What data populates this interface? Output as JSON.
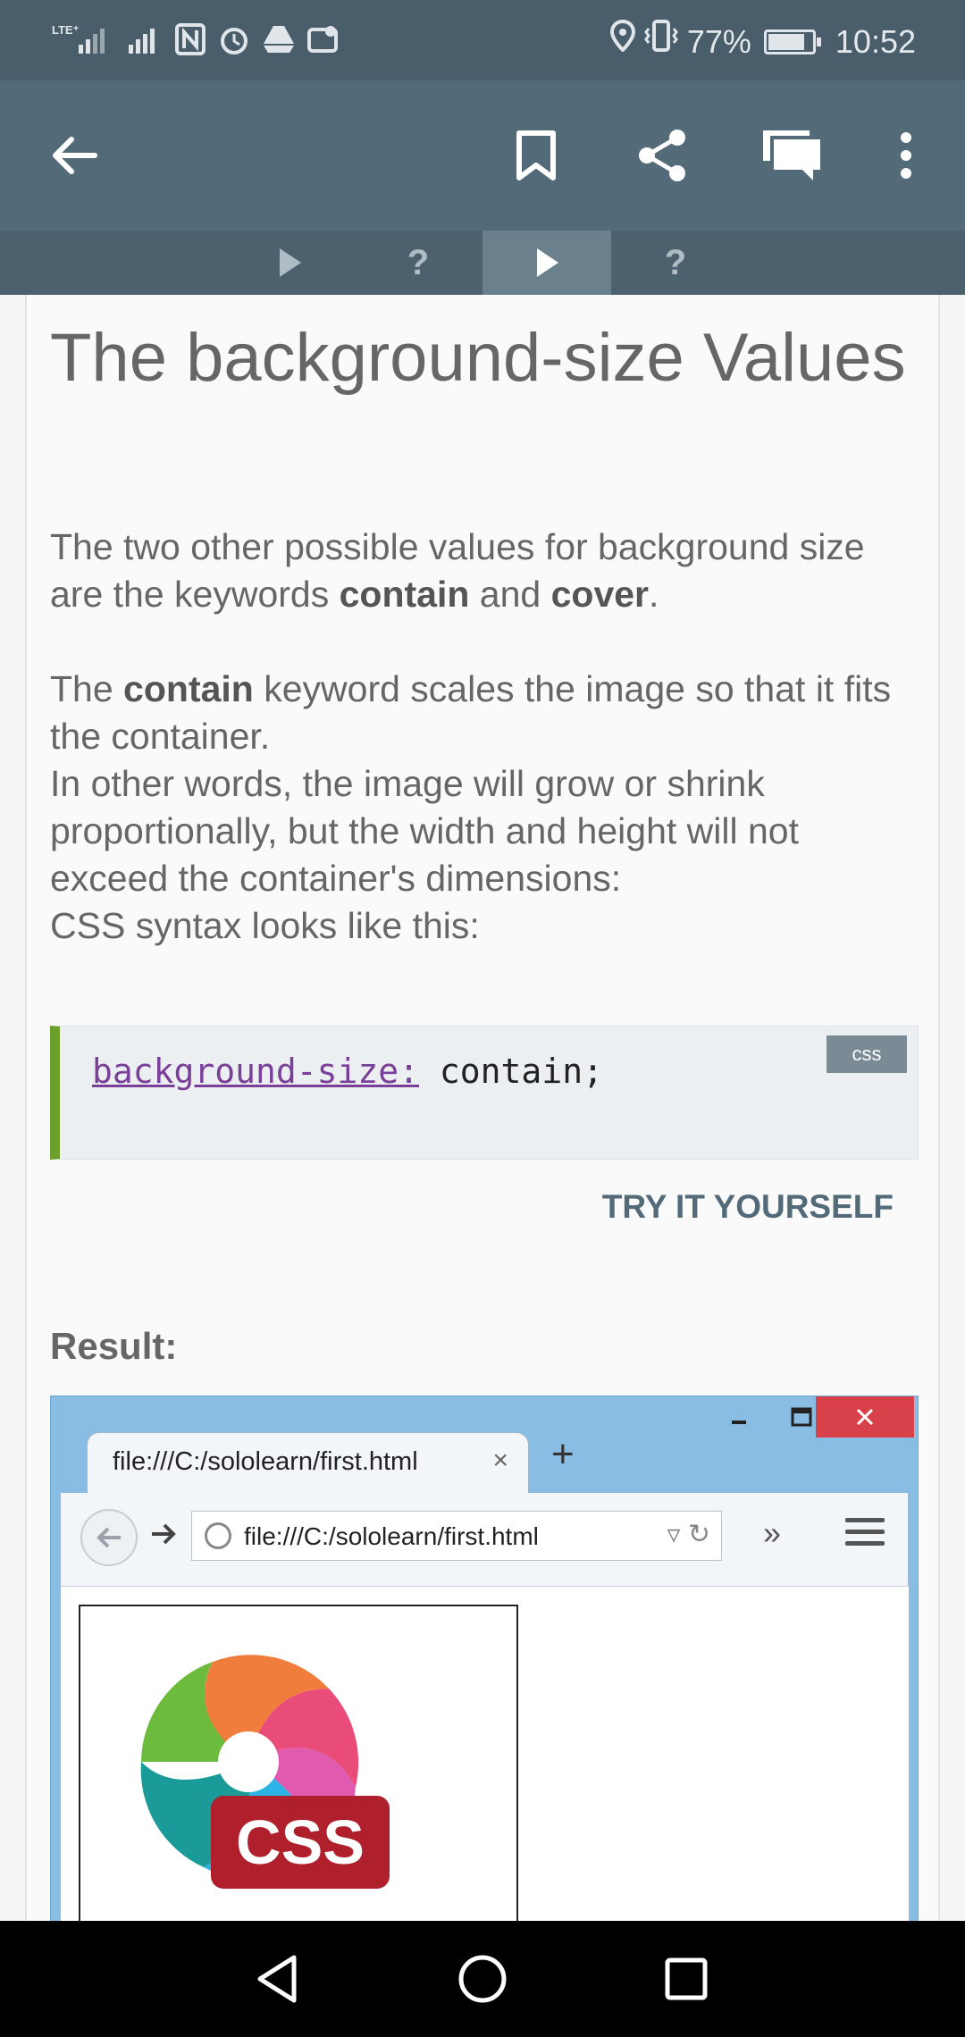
{
  "status_bar": {
    "left_icons": [
      "lte-signal-icon",
      "signal-icon",
      "nfc-icon",
      "alarm-icon",
      "drive-icon",
      "gallery-icon"
    ],
    "battery_percent": "77%",
    "time": "10:52"
  },
  "app_bar": {
    "icons": [
      "back-arrow-icon",
      "bookmark-icon",
      "share-icon",
      "comments-icon",
      "more-vert-icon"
    ]
  },
  "tabs": [
    {
      "label": "▶",
      "active": false
    },
    {
      "label": "?",
      "active": false
    },
    {
      "label": "▶",
      "active": true
    },
    {
      "label": "?",
      "active": false
    }
  ],
  "lesson": {
    "title": "The background-size Values",
    "para1_a": "The two other possible values for background size are the keywords ",
    "para1_b1": "contain",
    "para1_mid": " and ",
    "para1_b2": "cover",
    "para1_end": ".",
    "para2_a": "The ",
    "para2_b": "contain",
    "para2_c": " keyword scales the image so that it fits the container.",
    "para3": "In other words, the image will grow or shrink proportionally, but the width and height will not exceed the container's dimensions:",
    "para4": "CSS syntax looks like this:",
    "code_property": "background-size:",
    "code_value": " contain;",
    "code_badge": "css",
    "try_button": "TRY IT YOURSELF",
    "result_label": "Result:"
  },
  "browser_preview": {
    "tab_label": "file:///C:/sololearn/first.html",
    "tab_close": "×",
    "new_tab": "+",
    "url": "file:///C:/sololearn/first.html",
    "more": "»",
    "logo_text": "CSS",
    "colors": {
      "orange": "#f07d3c",
      "pink": "#e94c78",
      "magenta": "#e05ab0",
      "green": "#6cbb3c",
      "teal": "#1a9a98",
      "blue": "#2bb3e6",
      "badge_red": "#b01f2c"
    }
  },
  "nav_bar": {
    "icons": [
      "back-triangle-icon",
      "home-circle-icon",
      "recents-square-icon"
    ]
  }
}
